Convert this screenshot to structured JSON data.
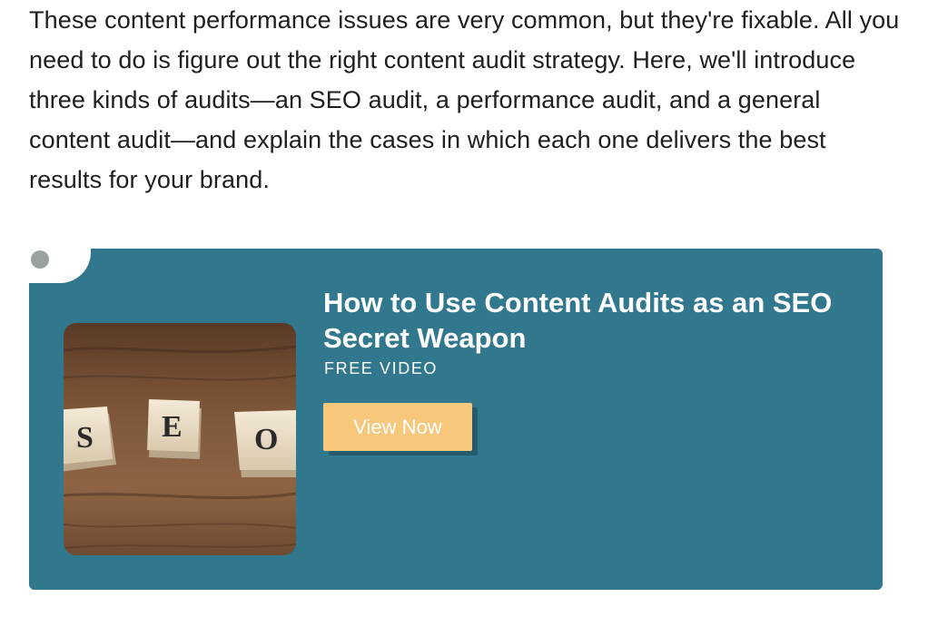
{
  "article": {
    "paragraph": "These content performance issues are very common, but they're fixable. All you need to do is figure out the right content audit strategy. Here, we'll introduce three kinds of audits—an SEO audit, a performance audit, and a general content audit—and explain the cases in which each one delivers the best results for your brand."
  },
  "cta": {
    "title": "How to Use Content Audits as an SEO Secret Weapon",
    "subtitle": "FREE VIDEO",
    "button_label": "View Now",
    "image_tiles": [
      "S",
      "E",
      "O"
    ],
    "colors": {
      "card_background": "#31788f",
      "button_background": "#f7c87b",
      "text": "#ffffff"
    }
  }
}
